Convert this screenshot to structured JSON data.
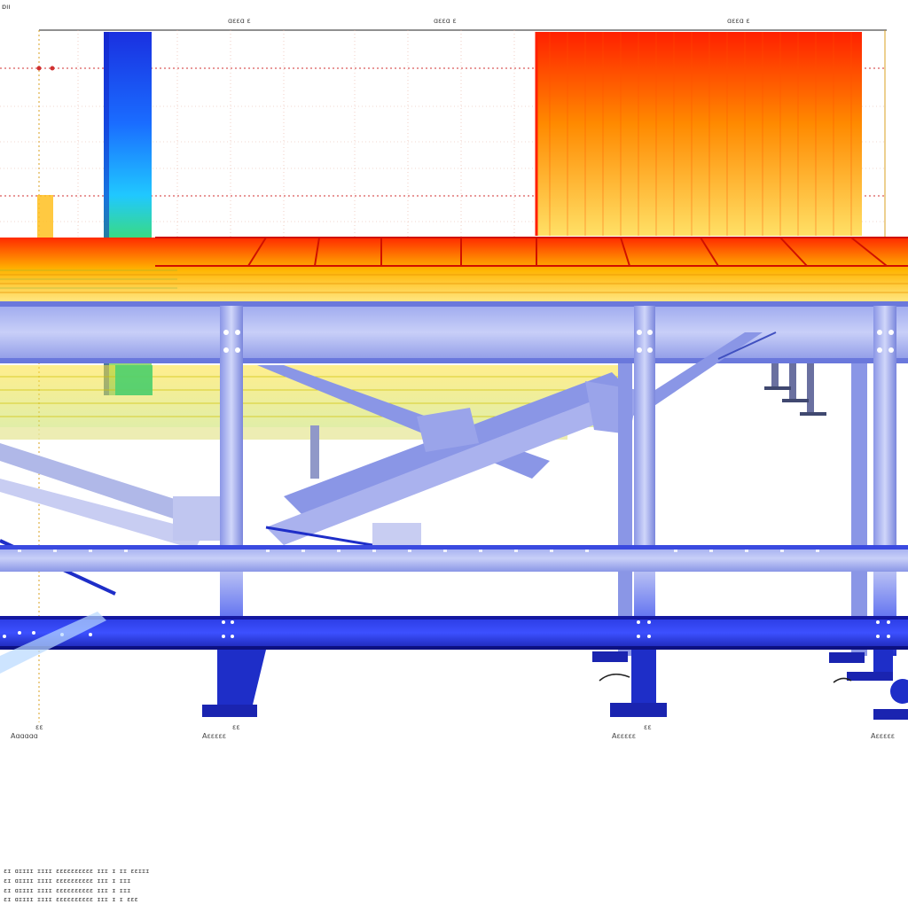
{
  "viewport": {
    "corner_label": "ɒıı",
    "top_axis_labels": [
      "ɑɛɛɑ ɛ",
      "ɑɛɛɑ ɛ",
      "ɑɛɛɑ ɛ"
    ],
    "bottom_labels": [
      "Aɑɑɑɑɑ",
      "Aɛɛɛɛɛ",
      "Aɛɛɛɛɛ",
      "Aɛɛɛɛɛ"
    ],
    "bottom_values": [
      "ɛɛ",
      "ɛɛ",
      "ɛɛ"
    ]
  },
  "status_bar": {
    "lines": [
      "ɛɪ ɑɪɪɪɪ ɪɪɪɪ ɛɛɛɛɛɛɛɛɛɛ ɪɪɪ ɪ ɪɪ ɛɛɪɪɪ",
      "ɛɪ ɑɪɪɪɪ ɪɪɪɪ ɛɛɛɛɛɛɛɛɛɛ ɪɪɪ ɪ ɪɪɪ",
      "ɛɪ ɑɪɪɪɪ ɪɪɪɪ ɛɛɛɛɛɛɛɛɛɛ ɪɪɪ ɪ ɪɪɪ",
      "ɛɪ ɑɪɪɪɪ ɪɪɪɪ ɛɛɛɛɛɛɛɛɛɛ ɪɪɪ ɪ ɪ ɛɛɛ"
    ]
  },
  "colors": {
    "steel": "#8a96e6",
    "steel_dark": "#1e2ec8",
    "heat_high": "#ff1a00",
    "heat_mid": "#ffb000",
    "heat_low": "#ffe400",
    "cool": "#1a3cff",
    "guide": "#d03030"
  },
  "icons": [
    "node-marker-icon"
  ]
}
